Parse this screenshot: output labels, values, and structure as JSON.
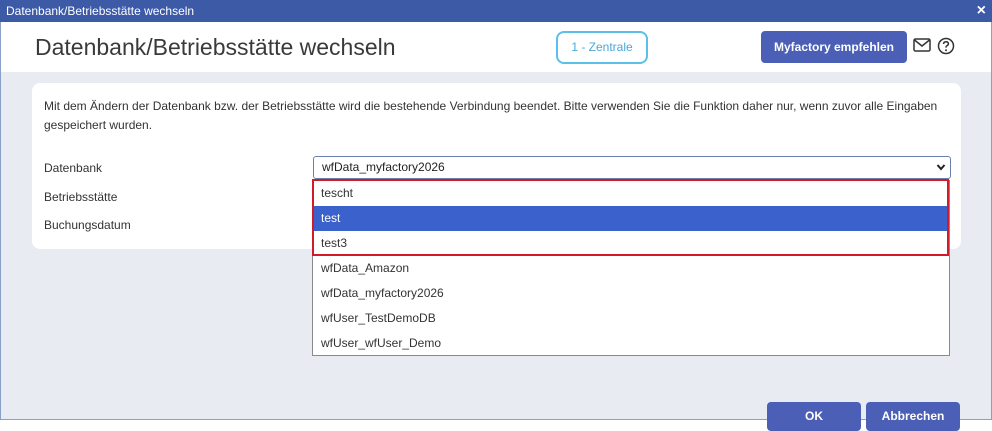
{
  "window": {
    "title": "Datenbank/Betriebsstätte wechseln",
    "close": "×"
  },
  "header": {
    "title": "Datenbank/Betriebsstätte wechseln",
    "badge": "1 - Zentrale",
    "recommend_button": "Myfactory empfehlen",
    "icons": [
      "mail-icon",
      "help-icon"
    ]
  },
  "info_text": "Mit dem Ändern der Datenbank bzw. der Betriebsstätte wird die bestehende Verbindung beendet. Bitte verwenden Sie die Funktion daher nur, wenn zuvor alle Eingaben gespeichert wurden.",
  "form": {
    "datenbank_label": "Datenbank",
    "betriebsstaette_label": "Betriebsstätte",
    "buchungsdatum_label": "Buchungsdatum",
    "datenbank_value": "wfData_myfactory2026"
  },
  "dropdown": {
    "options": [
      "tescht",
      "test",
      "test3",
      "wfData_Amazon",
      "wfData_myfactory2026",
      "wfUser_TestDemoDB",
      "wfUser_wfUser_Demo"
    ],
    "selected": "test"
  },
  "footer": {
    "ok": "OK",
    "cancel": "Abbrechen"
  },
  "colors": {
    "titlebar": "#3c5aa5",
    "button": "#4a5fb5",
    "selected": "#3b62cc",
    "highlight": "#d11a2a",
    "badge": "#5bc0e8"
  }
}
